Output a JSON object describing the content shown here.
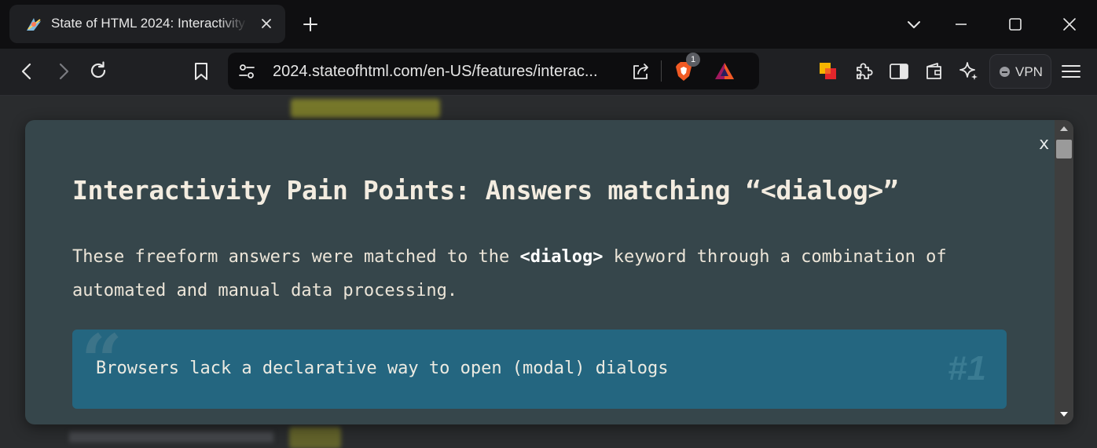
{
  "browser": {
    "tab": {
      "title": "State of HTML 2024: Interactivity"
    },
    "address_bar": {
      "url": "2024.stateofhtml.com/en-US/features/interac..."
    },
    "shields_badge_count": "1",
    "vpn_label": "VPN",
    "icons": [
      "favicon-icon",
      "close-icon",
      "plus-icon",
      "chevron-down-icon",
      "minimize-icon",
      "maximize-icon",
      "close-window-icon",
      "back-icon",
      "forward-icon",
      "reload-icon",
      "bookmark-icon",
      "site-settings-icon",
      "share-icon",
      "brave-shields-icon",
      "brave-rewards-icon",
      "extension-icon",
      "puzzle-icon",
      "sidebar-icon",
      "wallet-icon",
      "leo-ai-icon",
      "menu-icon"
    ]
  },
  "modal": {
    "close_label": "x",
    "title": "Interactivity Pain Points: Answers matching “<dialog>”",
    "description": {
      "before": "These freeform answers were matched to the ",
      "keyword": "<dialog>",
      "after": " keyword through a combination of automated and manual data processing."
    },
    "answers": [
      {
        "rank": "#1",
        "text": "Browsers lack a declarative way to open (modal) dialogs"
      }
    ]
  },
  "colors": {
    "modal_bg": "#36464b",
    "answer_card_bg": "#246680",
    "title_text": "#f3ece0"
  }
}
